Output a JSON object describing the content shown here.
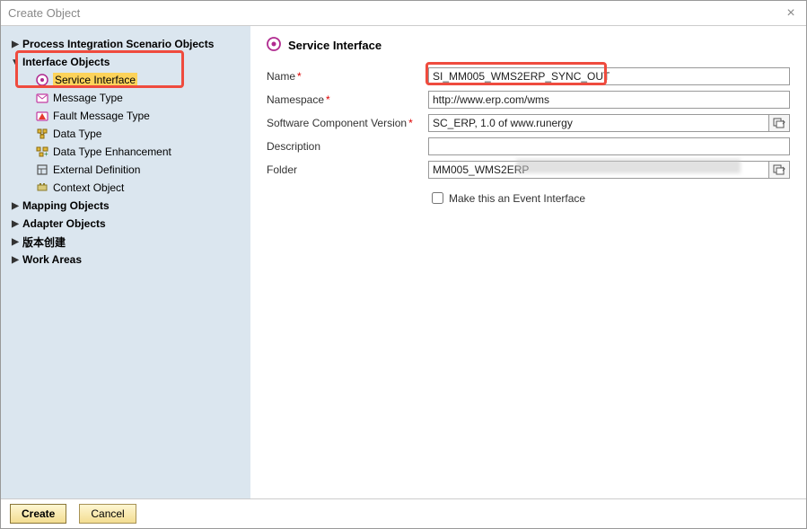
{
  "window": {
    "title": "Create Object"
  },
  "tree": {
    "items": [
      {
        "label": "Process Integration Scenario Objects"
      },
      {
        "label": "Interface Objects"
      },
      {
        "label": "Service Interface"
      },
      {
        "label": "Message Type"
      },
      {
        "label": "Fault Message Type"
      },
      {
        "label": "Data Type"
      },
      {
        "label": "Data Type Enhancement"
      },
      {
        "label": "External Definition"
      },
      {
        "label": "Context Object"
      },
      {
        "label": "Mapping Objects"
      },
      {
        "label": "Adapter Objects"
      },
      {
        "label": "版本创建"
      },
      {
        "label": "Work Areas"
      }
    ]
  },
  "main": {
    "heading": "Service Interface",
    "fields": {
      "name_label": "Name",
      "name_value": "SI_MM005_WMS2ERP_SYNC_OUT",
      "namespace_label": "Namespace",
      "namespace_value": "http://www.erp.com/wms",
      "scv_label": "Software Component Version",
      "scv_value": "SC_ERP, 1.0 of www.runergy",
      "description_label": "Description",
      "description_value": "",
      "folder_label": "Folder",
      "folder_value": "MM005_WMS2ERP"
    },
    "checkbox_label": "Make this an Event Interface"
  },
  "buttons": {
    "create": "Create",
    "cancel": "Cancel"
  }
}
